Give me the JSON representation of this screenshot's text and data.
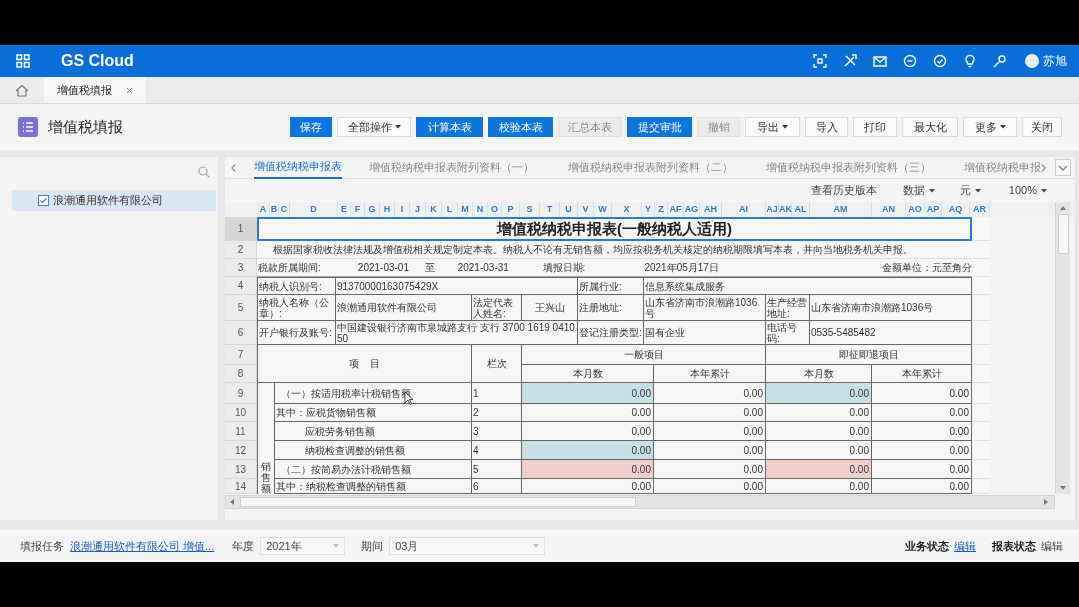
{
  "header": {
    "title": "GS Cloud",
    "user": "苏旭"
  },
  "tabs": [
    {
      "label": "增值税填报",
      "selected": true
    }
  ],
  "toolbar": {
    "title": "增值税填报",
    "buttons": [
      {
        "label": "保存",
        "kind": "primary",
        "disabled": false,
        "dropdown": false
      },
      {
        "label": "全部操作",
        "kind": "default",
        "disabled": false,
        "dropdown": true
      },
      {
        "label": "计算本表",
        "kind": "primary",
        "disabled": false,
        "dropdown": false
      },
      {
        "label": "校验本表",
        "kind": "primary",
        "disabled": false,
        "dropdown": false
      },
      {
        "label": "汇总本表",
        "kind": "default",
        "disabled": true,
        "dropdown": false
      },
      {
        "label": "提交审批",
        "kind": "primary",
        "disabled": false,
        "dropdown": false
      },
      {
        "label": "撤销",
        "kind": "default",
        "disabled": true,
        "dropdown": false
      },
      {
        "label": "导出",
        "kind": "default",
        "disabled": false,
        "dropdown": true
      },
      {
        "label": "导入",
        "kind": "default",
        "disabled": false,
        "dropdown": false
      },
      {
        "label": "打印",
        "kind": "default",
        "disabled": false,
        "dropdown": false
      },
      {
        "label": "最大化",
        "kind": "default",
        "disabled": false,
        "dropdown": false
      },
      {
        "label": "更多",
        "kind": "default",
        "disabled": false,
        "dropdown": true
      },
      {
        "label": "关闭",
        "kind": "default",
        "disabled": false,
        "dropdown": false
      }
    ]
  },
  "sidebar": {
    "items": [
      {
        "label": "浪潮通用软件有限公司",
        "selected": true
      }
    ]
  },
  "sheet_tabs": [
    {
      "label": "增值税纳税申报表",
      "selected": true
    },
    {
      "label": "增值税纳税申报表附列资料（一）",
      "selected": false
    },
    {
      "label": "增值税纳税申报表附列资料（二）",
      "selected": false
    },
    {
      "label": "增值税纳税申报表附列资料（三）",
      "selected": false
    },
    {
      "label": "增值税纳税申报",
      "selected": false
    }
  ],
  "sheet_toolbar": {
    "history": "查看历史版本",
    "menus": [
      "数据",
      "元",
      "100%"
    ]
  },
  "columns": [
    "A",
    "B",
    "C",
    "D",
    "E",
    "F",
    "G",
    "H",
    "I",
    "J",
    "K",
    "L",
    "M",
    "N",
    "O",
    "P",
    "S",
    "T",
    "U",
    "V",
    "W",
    "X",
    "Y",
    "Z",
    "AF",
    "AG",
    "AH",
    "AI",
    "AJ",
    "AK",
    "AL",
    "AM",
    "AN",
    "AO",
    "AP",
    "AQ",
    "AR"
  ],
  "row_numbers": [
    "1",
    "2",
    "3",
    "4",
    "5",
    "6",
    "7",
    "8",
    "9",
    "10",
    "11",
    "12",
    "13",
    "14"
  ],
  "sheet": {
    "title": "增值税纳税申报表(一般纳税人适用)",
    "title_selected": true,
    "note": "根据国家税收法律法规及增值税相关规定制定本表。纳税人不论有无销售额，均应按税务机关核定的纳税期限填写本表，并向当地税务机关申报。",
    "period": {
      "label": "税款所属期间:",
      "from": "2021-03-01",
      "to_label": "至",
      "to": "2021-03-31",
      "date_label": "填报日期:",
      "date": "2021年05月17日",
      "unit": "金额单位：元至角分"
    },
    "info_rows": [
      [
        "纳税人识别号:",
        "91370000163075429X",
        "所属行业:",
        "信息系统集成服务"
      ],
      [
        "纳税人名称（公章）:",
        "浪潮通用软件有限公司",
        "法定代表人姓名:",
        "王兴山",
        "注册地址:",
        "山东省济南市浪潮路1036号",
        "生产经营地址:",
        "山东省济南市浪潮路1036号"
      ],
      [
        "开户银行及账号:",
        "中国建设银行济南市泉城路支行 支行 3700 1619 0410 50",
        "登记注册类型:",
        "国有企业",
        "电话号码:",
        "0535-5485482"
      ]
    ],
    "head": {
      "item": "项    目",
      "line": "栏次",
      "group1": "一般项目",
      "group2": "即征即退项目",
      "sub": [
        "本月数",
        "本年累计",
        "本月数",
        "本年累计"
      ]
    },
    "section": "销售额",
    "rows": [
      {
        "item": "（一）按适用税率计税销售额",
        "kind": "main",
        "line": "1",
        "values": [
          {
            "text": "0.00",
            "color": "#c7dfe7"
          },
          {
            "text": "0.00"
          },
          {
            "text": "0.00",
            "color": "#c7dfe7"
          },
          {
            "text": "0.00"
          }
        ]
      },
      {
        "item": "其中：应税货物销售额",
        "kind": "sub",
        "line": "2",
        "values": [
          {
            "text": "0.00"
          },
          {
            "text": "0.00"
          },
          {
            "text": "0.00"
          },
          {
            "text": "0.00"
          }
        ]
      },
      {
        "item": "应税劳务销售额",
        "kind": "sub2",
        "line": "3",
        "values": [
          {
            "text": "0.00"
          },
          {
            "text": "0.00"
          },
          {
            "text": "0.00"
          },
          {
            "text": "0.00"
          }
        ]
      },
      {
        "item": "纳税检查调整的销售额",
        "kind": "sub2",
        "line": "4",
        "values": [
          {
            "text": "0.00",
            "color": "#c7dfe7"
          },
          {
            "text": "0.00"
          },
          {
            "text": "0.00"
          },
          {
            "text": "0.00"
          }
        ]
      },
      {
        "item": "（二）按简易办法计税销售额",
        "kind": "main",
        "line": "5",
        "values": [
          {
            "text": "0.00",
            "color": "#efd0cb"
          },
          {
            "text": "0.00"
          },
          {
            "text": "0.00",
            "color": "#efd0cb"
          },
          {
            "text": "0.00"
          }
        ]
      },
      {
        "item": "其中：纳税检查调整的销售额",
        "kind": "sub",
        "line": "6",
        "values": [
          {
            "text": "0.00"
          },
          {
            "text": "0.00"
          },
          {
            "text": "0.00"
          },
          {
            "text": "0.00"
          }
        ]
      }
    ]
  },
  "status_bar": {
    "task_label": "填报任务",
    "task": "浪潮通用软件有限公司 增值...",
    "year_label": "年度",
    "year": "2021年",
    "period_label": "期间",
    "period": "03月",
    "biz_label": "业务状态",
    "biz": "编辑",
    "report_label": "报表状态",
    "report": "编辑"
  }
}
